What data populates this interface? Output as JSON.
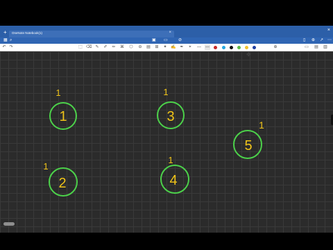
{
  "window": {
    "tab_title": "OneNote Notebook(1)",
    "tab_close_glyph": "×",
    "new_tab_glyph": "+",
    "close_glyph": "×"
  },
  "toolbar": {
    "undo_glyph": "↶",
    "redo_glyph": "↷",
    "pen_colors": [
      "#c62828",
      "#26a6e0",
      "#111111",
      "#5dba47",
      "#f2c230",
      "#1e3fa0"
    ],
    "icons": [
      "lasso-icon",
      "eraser-icon",
      "pen-icon",
      "pencil-icon",
      "highlighter-icon",
      "text-icon",
      "shape-icon",
      "ruler-icon",
      "image-icon",
      "add-page-icon",
      "page-icon",
      "share-icon",
      "more-icon"
    ]
  },
  "canvas": {
    "circle_stroke": "#4cd24a",
    "ink_color": "#f0c419",
    "circles": [
      {
        "number": "1",
        "mark": "1"
      },
      {
        "number": "2",
        "mark": "1"
      },
      {
        "number": "3",
        "mark": "1"
      },
      {
        "number": "4",
        "mark": "1"
      },
      {
        "number": "5",
        "mark": "1"
      }
    ]
  }
}
